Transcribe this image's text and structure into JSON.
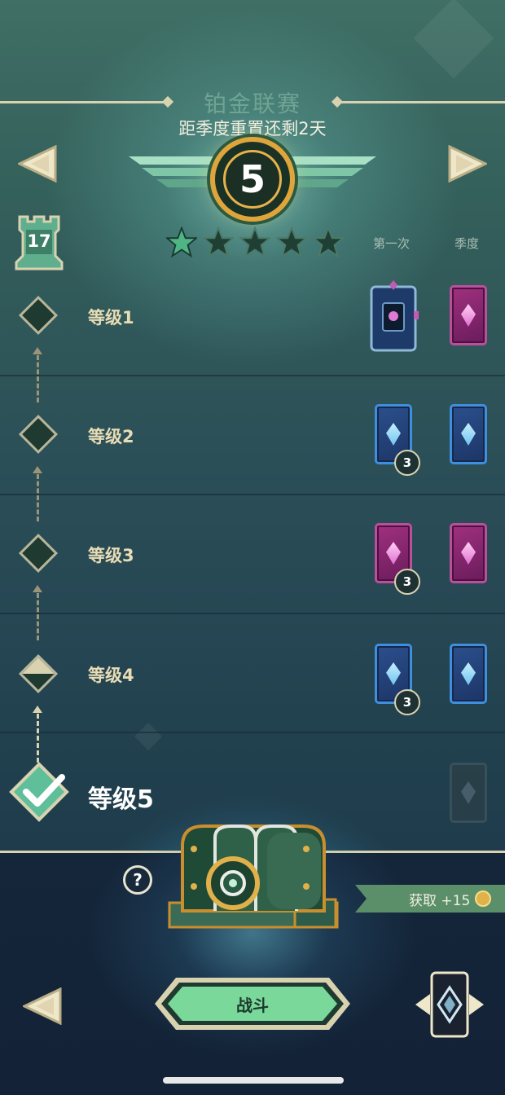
{
  "header": {
    "league_name": "铂金联赛",
    "season_reset": "距季度重置还剩2天",
    "league_level": "5"
  },
  "player": {
    "tower_rank": "17",
    "stars_filled": 1,
    "stars_total": 5
  },
  "columns": {
    "first_time": "第一次",
    "season": "季度"
  },
  "levels": [
    {
      "label": "等级1"
    },
    {
      "label": "等级2",
      "count": "3"
    },
    {
      "label": "等级3",
      "count": "3"
    },
    {
      "label": "等级4",
      "count": "3"
    },
    {
      "label": "等级5"
    }
  ],
  "bottom": {
    "help_label": "?",
    "reward_text": "获取 +15",
    "fight_label": "战斗"
  },
  "colors": {
    "accent": "#d9d2b0",
    "button_green": "#79d89a",
    "card_blue": "#3e8fe0",
    "card_pink": "#b9509a"
  }
}
